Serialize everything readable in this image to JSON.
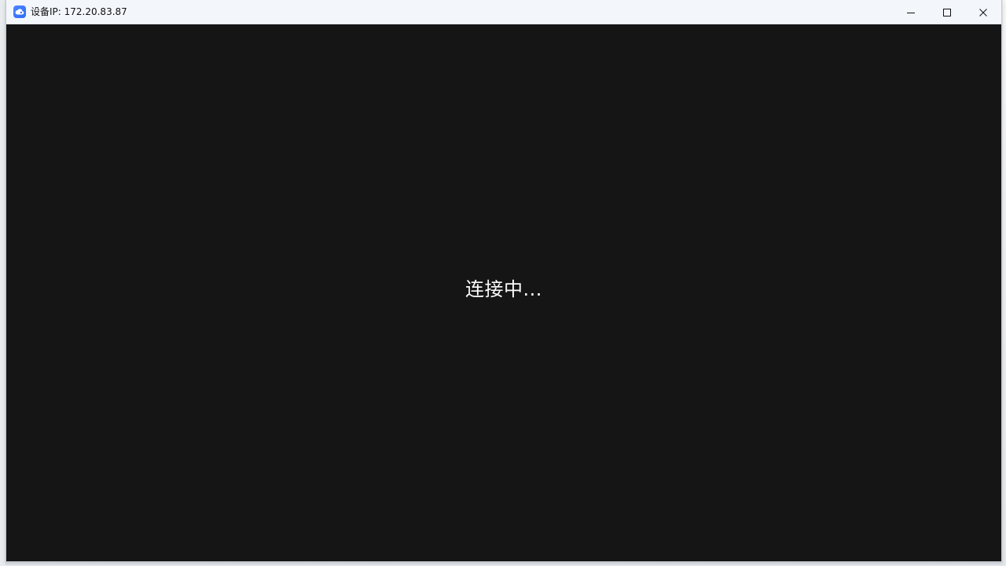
{
  "window": {
    "title": "设备IP: 172.20.83.87"
  },
  "titlebar": {
    "app_icon": "cloud-app-icon",
    "controls": {
      "minimize_icon": "minimize-icon",
      "maximize_icon": "maximize-icon",
      "close_icon": "close-icon"
    }
  },
  "main": {
    "status_text": "连接中..."
  },
  "colors": {
    "titlebar_bg": "#f3f6fb",
    "content_bg": "#151515",
    "accent": "#3b7bff"
  }
}
